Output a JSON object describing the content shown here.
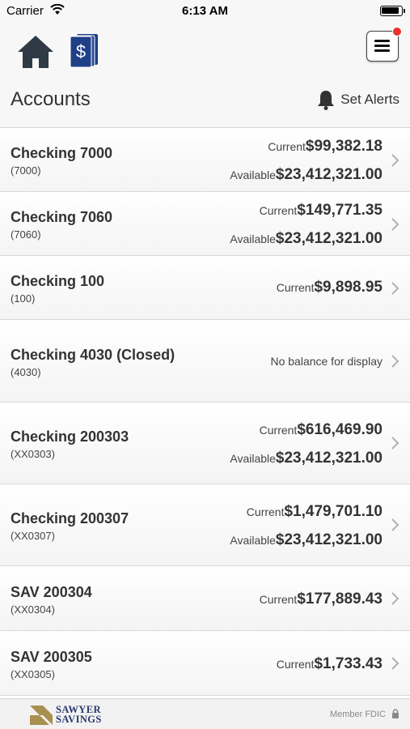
{
  "status_bar": {
    "carrier": "Carrier",
    "time": "6:13 AM"
  },
  "nav": {
    "icons": [
      "home-icon",
      "accounts-icon",
      "menu-icon"
    ]
  },
  "header": {
    "title": "Accounts",
    "alerts_label": "Set Alerts"
  },
  "accounts": [
    {
      "name": "Checking 7000",
      "number": "(7000)",
      "current_label": "Current",
      "current": "$99,382.18",
      "available_label": "Available",
      "available": "$23,412,321.00"
    },
    {
      "name": "Checking 7060",
      "number": "(7060)",
      "current_label": "Current",
      "current": "$149,771.35",
      "available_label": "Available",
      "available": "$23,412,321.00"
    },
    {
      "name": "Checking 100",
      "number": "(100)",
      "current_label": "Current",
      "current": "$9,898.95"
    },
    {
      "name": "Checking 4030 (Closed)",
      "number": "(4030)",
      "no_balance": "No balance for display"
    },
    {
      "name": "Checking 200303",
      "number": "(XX0303)",
      "current_label": "Current",
      "current": "$616,469.90",
      "available_label": "Available",
      "available": "$23,412,321.00"
    },
    {
      "name": "Checking 200307",
      "number": "(XX0307)",
      "current_label": "Current",
      "current": "$1,479,701.10",
      "available_label": "Available",
      "available": "$23,412,321.00"
    },
    {
      "name": "SAV 200304",
      "number": "(XX0304)",
      "current_label": "Current",
      "current": "$177,889.43"
    },
    {
      "name": "SAV 200305",
      "number": "(XX0305)",
      "current_label": "Current",
      "current": "$1,733.43"
    }
  ],
  "footer": {
    "logo_line1": "SAWYER",
    "logo_line2": "SAVINGS",
    "member_fdic": "Member FDIC"
  },
  "colors": {
    "accent_blue": "#1f3f87",
    "badge_red": "#e8312f",
    "logo_gold": "#a8904f"
  }
}
